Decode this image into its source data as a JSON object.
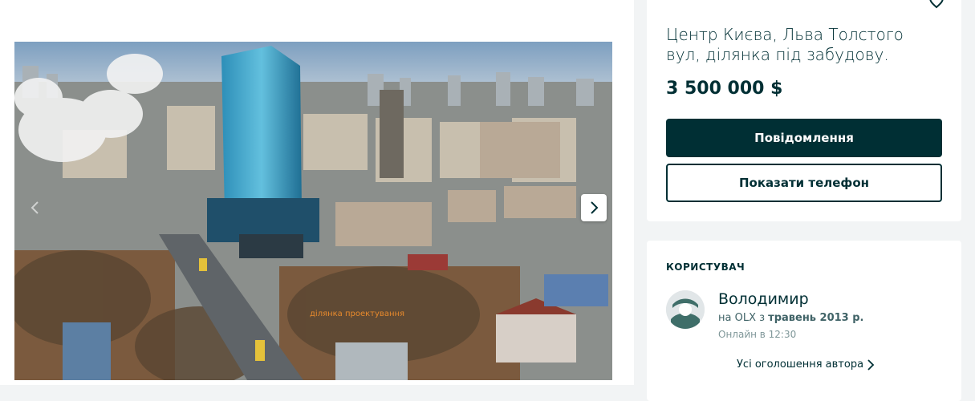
{
  "gallery": {
    "photo_caption": "ділянка проектування",
    "next_icon": "chevron-right-icon",
    "prev_icon": "chevron-left-icon"
  },
  "listing": {
    "title": "Центр Києва, Льва Толстого вул, ділянка під забудову.",
    "price": "3 500 000 $",
    "message_button": "Повідомлення",
    "phone_button": "Показати телефон",
    "favorite_icon": "heart-icon"
  },
  "user": {
    "heading": "КОРИСТУВАЧ",
    "name": "Володимир",
    "member_prefix": "на OLX з ",
    "member_since": "травень 2013 р.",
    "online": "Онлайн в 12:30",
    "all_ads_link": "Усі оголошення автора"
  },
  "colors": {
    "brand_dark": "#002f34",
    "page_bg": "#f2f4f5"
  }
}
